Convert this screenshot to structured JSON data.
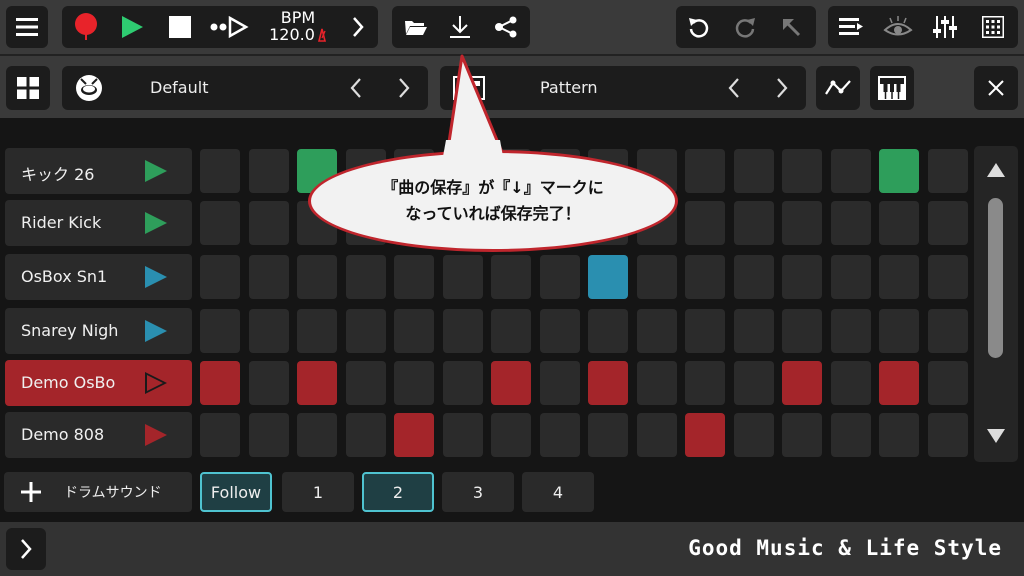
{
  "top_bar": {
    "bpm_label": "BPM",
    "bpm_value": "120.0"
  },
  "second_bar": {
    "kit_name": "Default",
    "pattern_name": "Pattern"
  },
  "tracks": [
    {
      "name": "キック 26",
      "color": "#2e9e5b",
      "selected": false
    },
    {
      "name": "Rider Kick",
      "color": "#2e9e5b",
      "selected": false
    },
    {
      "name": "OsBox Sn1",
      "color": "#2a8fb0",
      "selected": false
    },
    {
      "name": "Snarey Nigh",
      "color": "#2a8fb0",
      "selected": false
    },
    {
      "name": "Demo OsBo",
      "color": "#a4252a",
      "selected": true
    },
    {
      "name": "Demo 808",
      "color": "#a4252a",
      "selected": false
    }
  ],
  "steps": [
    [
      0,
      0,
      1,
      0,
      0,
      0,
      0,
      0,
      0,
      0,
      0,
      0,
      0,
      0,
      1,
      0
    ],
    [
      0,
      0,
      0,
      0,
      0,
      0,
      0,
      0,
      0,
      0,
      0,
      0,
      0,
      0,
      0,
      0
    ],
    [
      0,
      0,
      0,
      0,
      0,
      0,
      0,
      0,
      1,
      0,
      0,
      0,
      0,
      0,
      0,
      0
    ],
    [
      0,
      0,
      0,
      0,
      0,
      0,
      0,
      0,
      0,
      0,
      0,
      0,
      0,
      0,
      0,
      0
    ],
    [
      1,
      0,
      1,
      0,
      0,
      0,
      1,
      0,
      1,
      0,
      0,
      0,
      1,
      0,
      1,
      0
    ],
    [
      0,
      0,
      0,
      0,
      1,
      0,
      0,
      0,
      0,
      0,
      1,
      0,
      0,
      0,
      0,
      0
    ]
  ],
  "bottom": {
    "add_label": "ドラムサウンド",
    "follow_label": "Follow",
    "pages": [
      "1",
      "2",
      "3",
      "4"
    ],
    "active_page": "2"
  },
  "callout": {
    "line1": "『曲の保存』が『↓』マークに",
    "line2": "なっていれば保存完了！"
  },
  "footer": {
    "tagline": "Good Music & Life Style"
  },
  "colors": {
    "record": "#e8232a",
    "play": "#2ecc71",
    "accent_border": "#4fc3d0",
    "callout_border": "#c0262d"
  }
}
